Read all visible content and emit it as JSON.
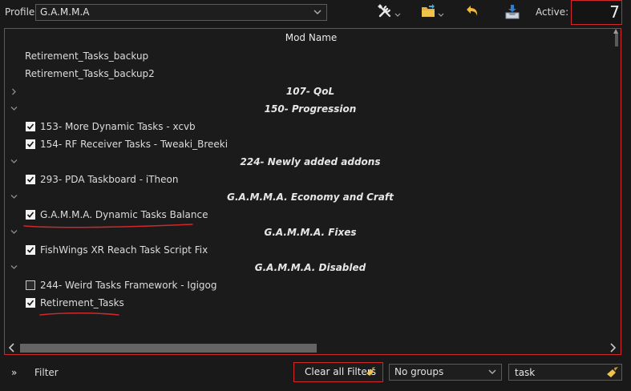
{
  "toolbar": {
    "profile_label": "Profile",
    "profile_value": "G.A.M.M.A",
    "active_label": "Active:",
    "active_count": "7",
    "icons": [
      "tools-icon",
      "folder-icon",
      "undo-icon",
      "archive-icon"
    ]
  },
  "list": {
    "column_header": "Mod Name",
    "rows": [
      {
        "type": "plain",
        "name": "Retirement_Tasks_backup"
      },
      {
        "type": "plain",
        "name": "Retirement_Tasks_backup2"
      },
      {
        "type": "group",
        "name": "107- QoL",
        "expanded": false
      },
      {
        "type": "group",
        "name": "150- Progression",
        "expanded": true
      },
      {
        "type": "mod",
        "name": "153- More Dynamic Tasks - xcvb",
        "checked": true
      },
      {
        "type": "mod",
        "name": "154- RF Receiver Tasks - Tweaki_Breeki",
        "checked": true
      },
      {
        "type": "group",
        "name": "224- Newly added addons",
        "expanded": true
      },
      {
        "type": "mod",
        "name": "293- PDA Taskboard - iTheon",
        "checked": true
      },
      {
        "type": "group",
        "name": "G.A.M.M.A. Economy and Craft",
        "expanded": true
      },
      {
        "type": "mod",
        "name": "G.A.M.M.A. Dynamic Tasks Balance",
        "checked": true
      },
      {
        "type": "group",
        "name": "G.A.M.M.A. Fixes",
        "expanded": true
      },
      {
        "type": "mod",
        "name": "FishWings XR Reach Task Script Fix",
        "checked": true
      },
      {
        "type": "group",
        "name": "G.A.M.M.A. Disabled",
        "expanded": true
      },
      {
        "type": "mod",
        "name": "244- Weird Tasks Framework - Igigog",
        "checked": false
      },
      {
        "type": "mod",
        "name": "Retirement_Tasks",
        "checked": true
      }
    ]
  },
  "bottom": {
    "filter_toggle": "»",
    "filter_label": "Filter",
    "clear_filters": "Clear all Filters",
    "groups_value": "No groups",
    "search_value": "task"
  },
  "colors": {
    "highlight": "#d0282b",
    "background": "#191919"
  }
}
